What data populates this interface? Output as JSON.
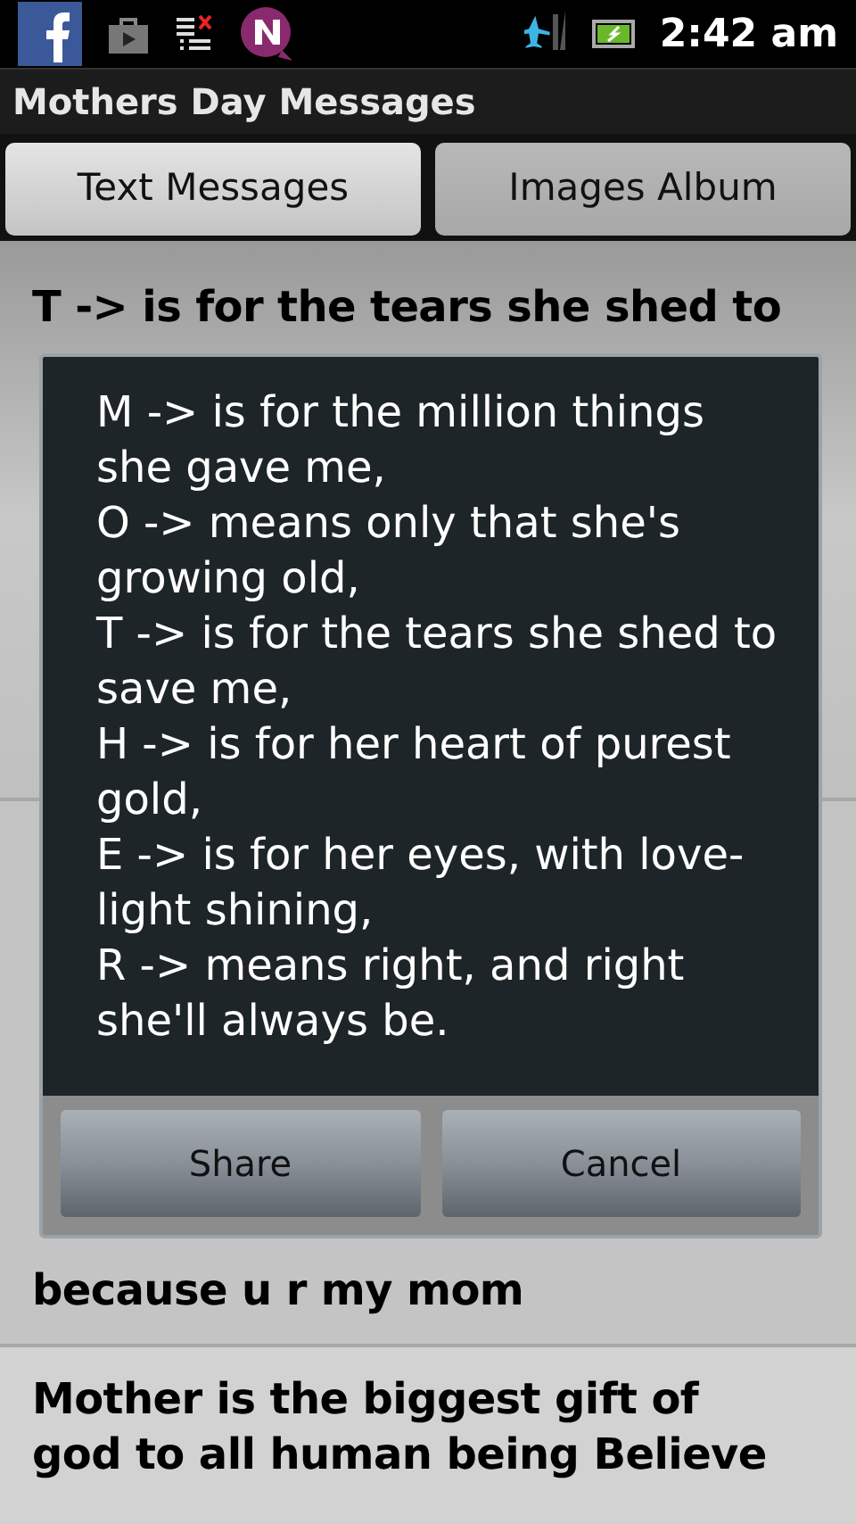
{
  "status_bar": {
    "time": "2:42 am"
  },
  "app_title": "Mothers Day Messages",
  "tabs": [
    {
      "label": "Text Messages",
      "selected": true
    },
    {
      "label": "Images Album",
      "selected": false
    }
  ],
  "messages": [
    {
      "lines": [
        "T -> is for the tears she shed to"
      ]
    },
    {
      "lines": [
        "because u r my mom"
      ]
    },
    {
      "lines": [
        "Mother is the biggest gift of",
        "god to all human being Believe"
      ]
    }
  ],
  "dialog": {
    "lines": [
      "M -> is for the million things",
      "she gave me,",
      "O -> means only that she's",
      "growing old,",
      "T -> is for the tears she shed to",
      "save me,",
      "H -> is for her heart of purest",
      "gold,",
      "E -> is for her eyes, with love-",
      "light shining,",
      "R -> means right, and right",
      "she'll always be."
    ],
    "buttons": [
      "Share",
      "Cancel"
    ]
  }
}
